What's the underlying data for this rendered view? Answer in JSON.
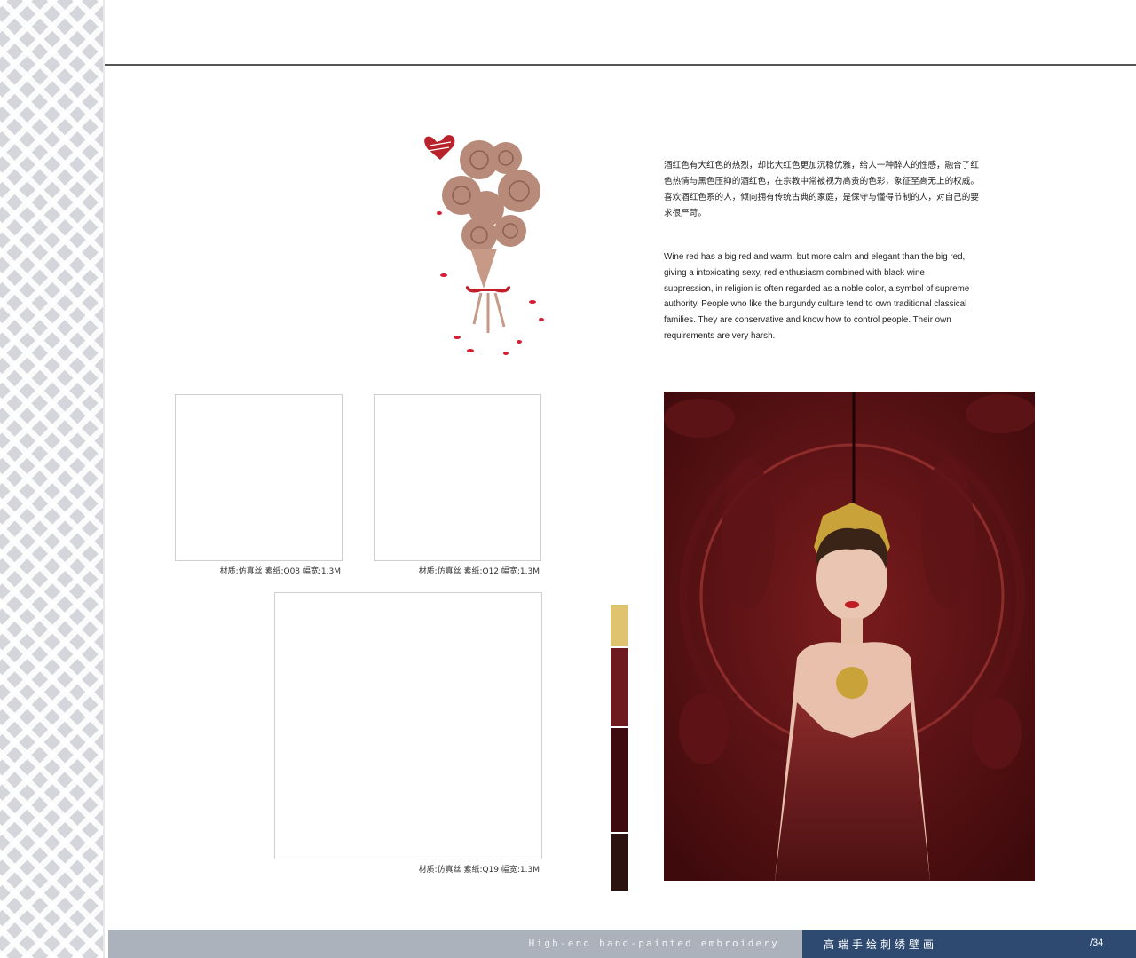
{
  "description_cn": "酒红色有大红色的热烈，却比大红色更加沉稳优雅，给人一种醉人的性感，融合了红色热情与黑色压抑的酒红色，在宗教中常被视为高贵的色彩，象征至高无上的权威。喜欢酒红色系的人，倾向拥有传统古典的家庭，是保守与懂得节制的人，对自己的要求很严苛。",
  "description_en": "Wine red has a big red and warm, but more calm and elegant than the big red, giving a intoxicating sexy, red enthusiasm combined with black wine suppression, in religion is often regarded as a noble color, a symbol of supreme authority. People who like the burgundy culture tend to own traditional classical families. They are conservative and know how to control people. Their own requirements are very harsh.",
  "samples": [
    {
      "caption": "材质:仿真丝   素纸:Q08   幅宽:1.3M"
    },
    {
      "caption": "材质:仿真丝   素纸:Q12   幅宽:1.3M"
    },
    {
      "caption": "材质:仿真丝  素纸:Q19   幅宽:1.3M"
    }
  ],
  "palette": [
    "#dfc36f",
    "#6e1b1f",
    "#3d0a0d",
    "#2b1410"
  ],
  "footer": {
    "tagline_en": "High-end hand-painted embroidery",
    "tagline_cn": "高端手绘刺绣壁画",
    "page_number": "/34"
  }
}
